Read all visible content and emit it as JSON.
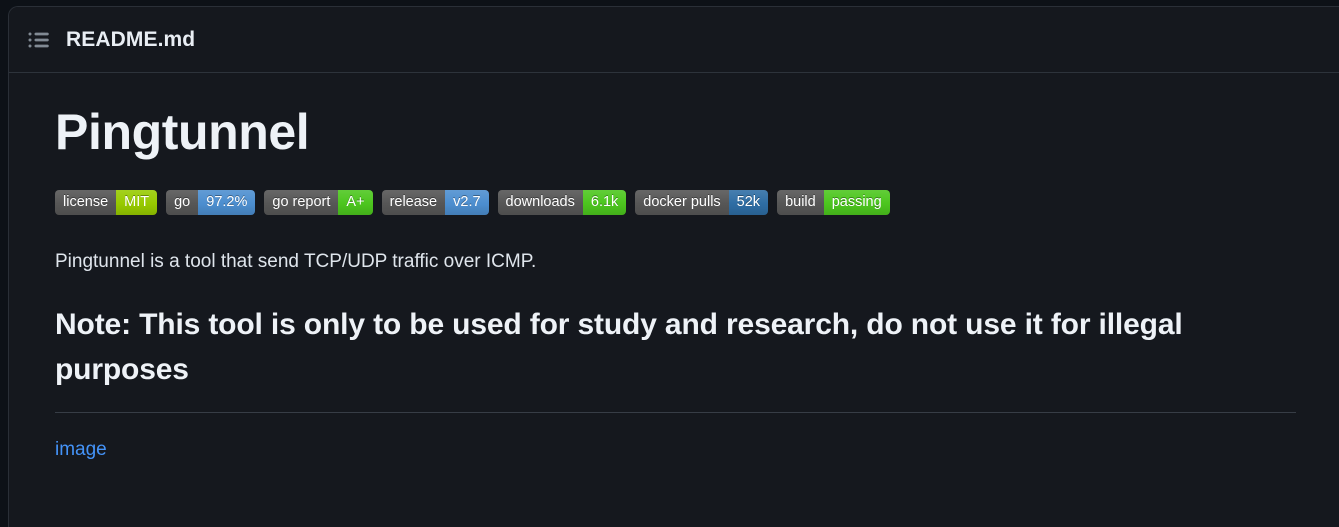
{
  "panel": {
    "background_color": "#15181e",
    "border_color": "#2a2f37"
  },
  "header": {
    "icon_name": "list-outline-icon",
    "file_name": "README.md"
  },
  "main": {
    "title": "Pingtunnel",
    "badges": [
      {
        "label": "license",
        "value": "MIT",
        "value_color": "#97ca00"
      },
      {
        "label": "go",
        "value": "97.2%",
        "value_color": "#4c8ecf"
      },
      {
        "label": "go report",
        "value": "A+",
        "value_color": "#4cc61e"
      },
      {
        "label": "release",
        "value": "v2.7",
        "value_color": "#4c8ecf"
      },
      {
        "label": "downloads",
        "value": "6.1k",
        "value_color": "#4cc61e"
      },
      {
        "label": "docker pulls",
        "value": "52k",
        "value_color": "#2e6da4"
      },
      {
        "label": "build",
        "value": "passing",
        "value_color": "#4cc61e"
      }
    ],
    "description": "Pingtunnel is a tool that send TCP/UDP traffic over ICMP.",
    "note_heading": "Note: This tool is only to be used for study and research, do not use it for illegal purposes",
    "image_link_text": "image",
    "link_color": "#4493f8"
  }
}
